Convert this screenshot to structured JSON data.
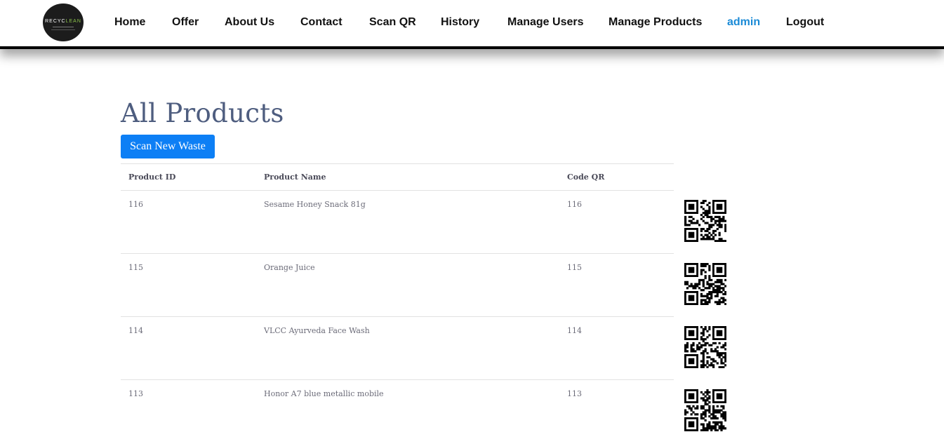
{
  "nav": {
    "logo_text_a": "RECYC",
    "logo_text_b": "LEAN",
    "items": [
      {
        "label": "Home"
      },
      {
        "label": "Offer"
      },
      {
        "label": "About Us"
      },
      {
        "label": "Contact"
      },
      {
        "label": "Scan QR"
      },
      {
        "label": "History"
      },
      {
        "label": "Manage Users"
      },
      {
        "label": "Manage Products"
      },
      {
        "label": "admin"
      },
      {
        "label": "Logout"
      }
    ],
    "active_color": "#1a8ad6"
  },
  "page": {
    "title": "All Products",
    "scan_button_label": "Scan New Waste",
    "button_color": "#0d7ff5"
  },
  "table": {
    "headers": [
      "Product ID",
      "Product Name",
      "Code QR"
    ],
    "rows": [
      {
        "id": "116",
        "name": "Sesame Honey Snack 81g",
        "code": "116"
      },
      {
        "id": "115",
        "name": "Orange Juice",
        "code": "115"
      },
      {
        "id": "114",
        "name": "VLCC Ayurveda Face Wash",
        "code": "114"
      },
      {
        "id": "113",
        "name": "Honor A7 blue metallic mobile",
        "code": "113"
      }
    ]
  },
  "icons": {
    "qr": "qr-code-icon"
  }
}
